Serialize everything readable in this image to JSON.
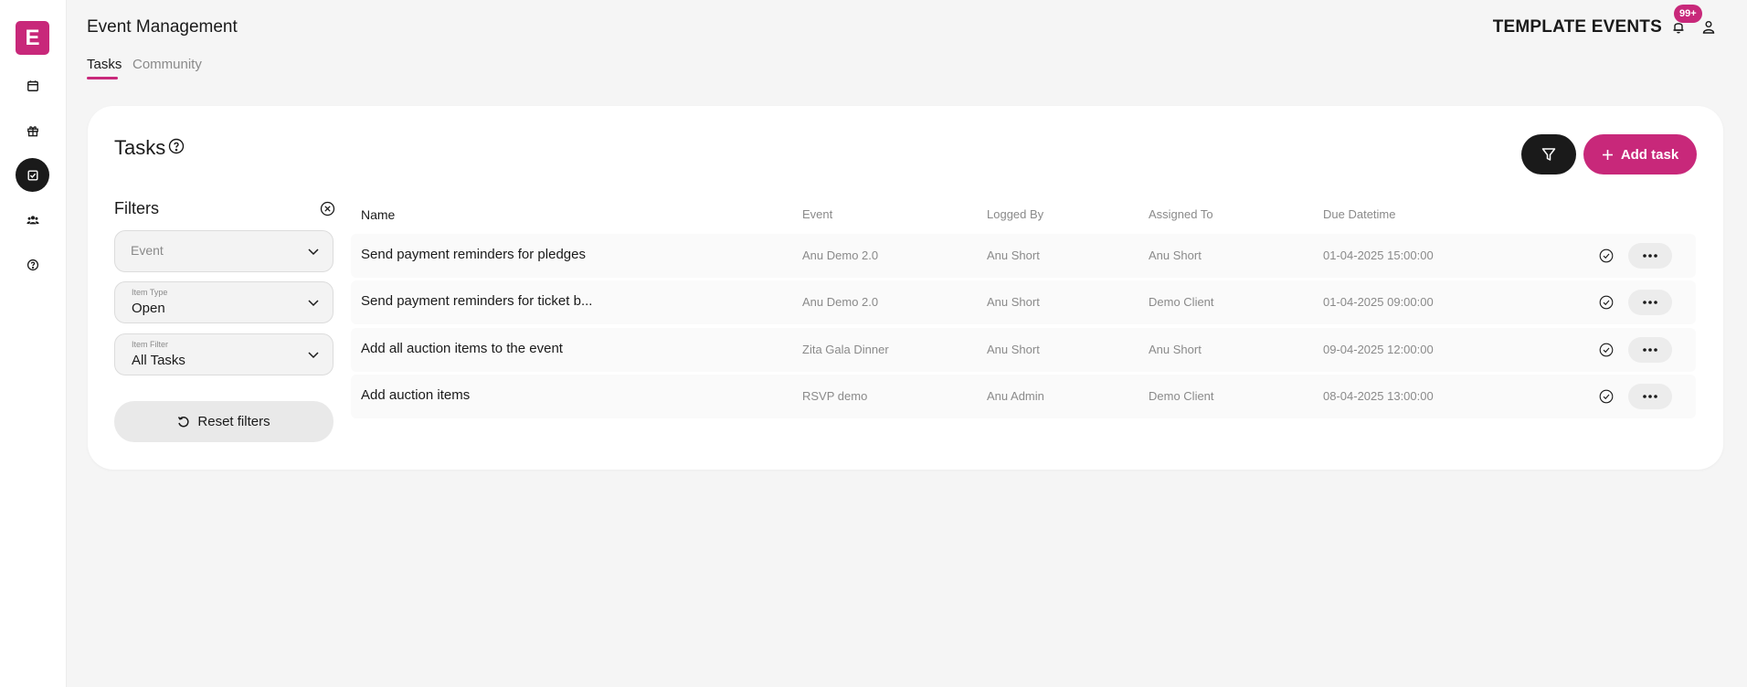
{
  "sidebar": {
    "logo_letter": "E",
    "items": [
      {
        "icon": "calendar-icon",
        "active": false
      },
      {
        "icon": "gift-icon",
        "active": false
      },
      {
        "icon": "checkbox-icon",
        "active": true
      },
      {
        "icon": "users-icon",
        "active": false
      },
      {
        "icon": "help-icon",
        "active": false
      }
    ]
  },
  "header": {
    "title": "Event Management",
    "tabs": [
      {
        "label": "Tasks",
        "active": true
      },
      {
        "label": "Community",
        "active": false
      }
    ],
    "org_name": "TEMPLATE EVENTS",
    "notification_badge": "99+"
  },
  "card": {
    "title": "Tasks",
    "add_button_label": "Add task"
  },
  "filters": {
    "title": "Filters",
    "event_placeholder": "Event",
    "item_type_label": "Item Type",
    "item_type_value": "Open",
    "item_filter_label": "Item Filter",
    "item_filter_value": "All Tasks",
    "reset_label": "Reset filters"
  },
  "table": {
    "columns": [
      "Name",
      "Event",
      "Logged By",
      "Assigned To",
      "Due Datetime"
    ],
    "rows": [
      {
        "name": "Send payment reminders for pledges",
        "event": "Anu Demo 2.0",
        "logged_by": "Anu Short",
        "assigned_to": "Anu Short",
        "due": "01-04-2025 15:00:00"
      },
      {
        "name": "Send payment reminders for ticket b...",
        "event": "Anu Demo 2.0",
        "logged_by": "Anu Short",
        "assigned_to": "Demo Client",
        "due": "01-04-2025 09:00:00"
      },
      {
        "name": "Add all auction items to the event",
        "event": "Zita Gala Dinner",
        "logged_by": "Anu Short",
        "assigned_to": "Anu Short",
        "due": "09-04-2025 12:00:00"
      },
      {
        "name": "Add auction items",
        "event": "RSVP demo",
        "logged_by": "Anu Admin",
        "assigned_to": "Demo Client",
        "due": "08-04-2025 13:00:00"
      }
    ]
  },
  "colors": {
    "accent": "#c8287a",
    "dark": "#1a1a1a",
    "background": "#f5f5f5"
  }
}
